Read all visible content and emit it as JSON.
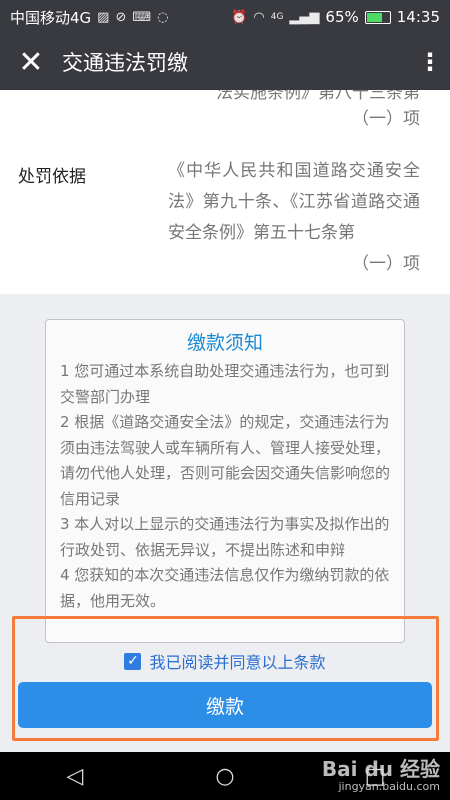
{
  "status_bar": {
    "carrier": "中国移动4G",
    "signal_label": "4G",
    "battery": "65%",
    "battery_level": 0.65,
    "time": "14:35"
  },
  "app_bar": {
    "title": "交通违法罚缴"
  },
  "info": {
    "top_fragment": "法实施条例》第八十三条第",
    "top_paren": "（一）项",
    "row_label": "处罚依据",
    "row_value": "《中华人民共和国道路交通安全法》第九十条、《江苏省道路交通安全条例》第五十七条第",
    "row_value_end": "（一）项"
  },
  "notice": {
    "title": "缴款须知",
    "items": [
      "1 您可通过本系统自助处理交通违法行为，也可到交警部门办理",
      "2 根据《道路交通安全法》的规定，交通违法行为须由违法驾驶人或车辆所有人、管理人接受处理，请勿代他人处理，否则可能会因交通失信影响您的信用记录",
      "3 本人对以上显示的交通违法行为事实及拟作出的行政处罚、依据无异议，不提出陈述和申辩",
      "4 您获知的本次交通违法信息仅作为缴纳罚款的依据，他用无效。"
    ]
  },
  "agree": {
    "label": "我已阅读并同意以上条款",
    "checked": true
  },
  "pay_button": {
    "label": "缴款"
  },
  "watermark": {
    "brand": "Bai du 经验",
    "url": "jingyan.baidu.com"
  },
  "colors": {
    "bar": "#393a3f",
    "accent": "#2d8ee8",
    "notice_title": "#1b8ad3",
    "highlight": "#f47b3c"
  }
}
